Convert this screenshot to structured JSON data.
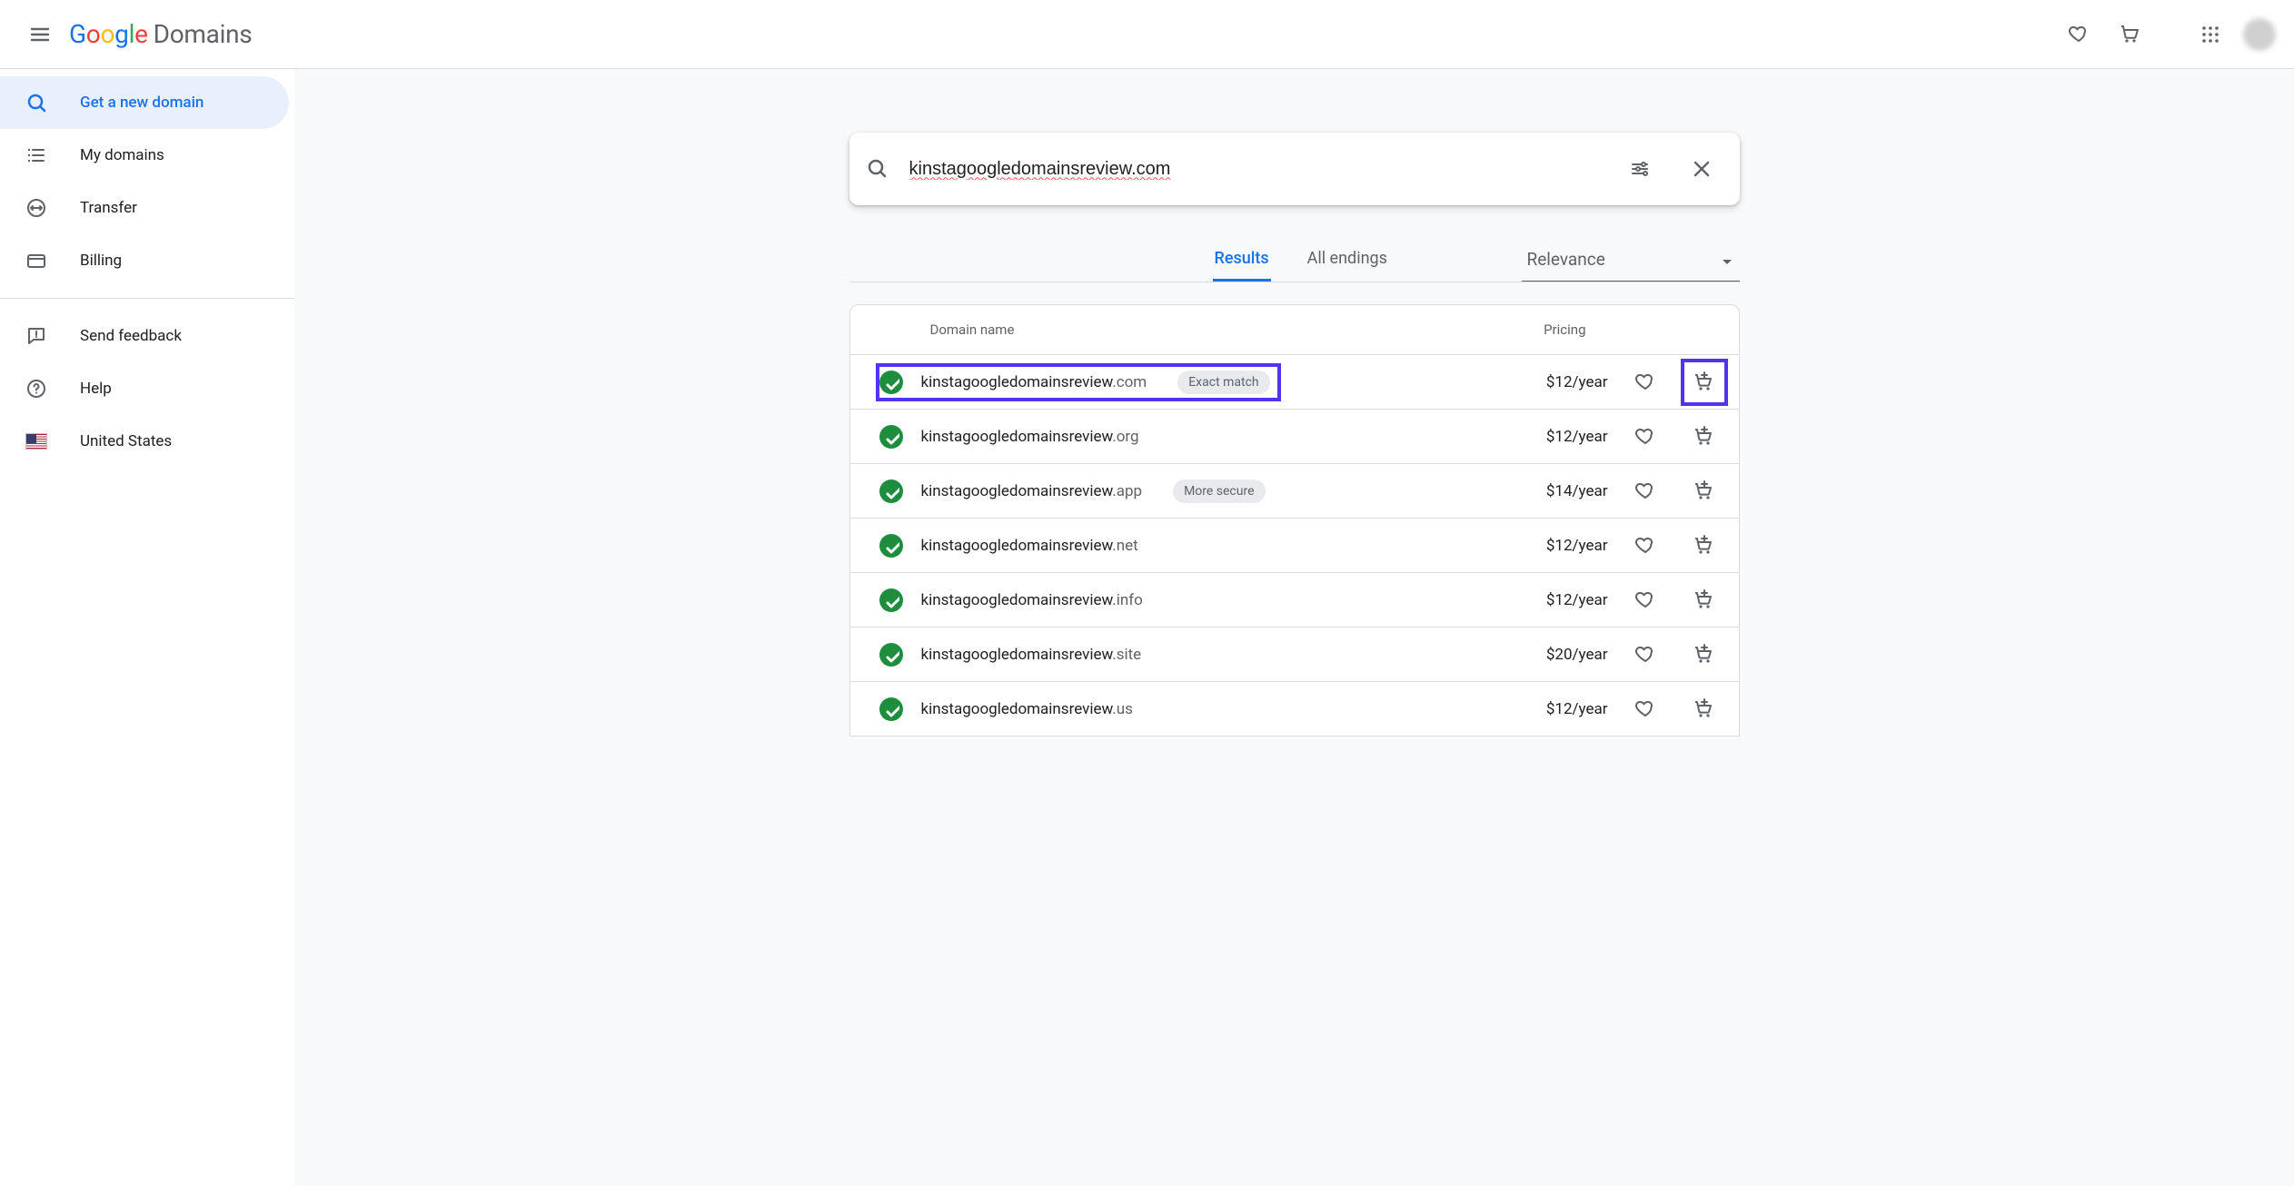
{
  "header": {
    "product_suffix": "Domains"
  },
  "sidebar": {
    "items": [
      {
        "label": "Get a new domain"
      },
      {
        "label": "My domains"
      },
      {
        "label": "Transfer"
      },
      {
        "label": "Billing"
      }
    ],
    "secondary": [
      {
        "label": "Send feedback"
      },
      {
        "label": "Help"
      },
      {
        "label": "United States"
      }
    ]
  },
  "search": {
    "value": "kinstagoogledomainsreview.com"
  },
  "controls": {
    "tabs": [
      {
        "label": "Results",
        "active": true
      },
      {
        "label": "All endings",
        "active": false
      }
    ],
    "sort_selected": "Relevance"
  },
  "results": {
    "col_domain": "Domain name",
    "col_pricing": "Pricing",
    "rows": [
      {
        "name": "kinstagoogledomainsreview",
        "tld": ".com",
        "chip": "Exact match",
        "price": "$12/year",
        "highlight": true
      },
      {
        "name": "kinstagoogledomainsreview",
        "tld": ".org",
        "chip": null,
        "price": "$12/year"
      },
      {
        "name": "kinstagoogledomainsreview",
        "tld": ".app",
        "chip": "More secure",
        "price": "$14/year"
      },
      {
        "name": "kinstagoogledomainsreview",
        "tld": ".net",
        "chip": null,
        "price": "$12/year"
      },
      {
        "name": "kinstagoogledomainsreview",
        "tld": ".info",
        "chip": null,
        "price": "$12/year"
      },
      {
        "name": "kinstagoogledomainsreview",
        "tld": ".site",
        "chip": null,
        "price": "$20/year"
      },
      {
        "name": "kinstagoogledomainsreview",
        "tld": ".us",
        "chip": null,
        "price": "$12/year"
      }
    ]
  }
}
